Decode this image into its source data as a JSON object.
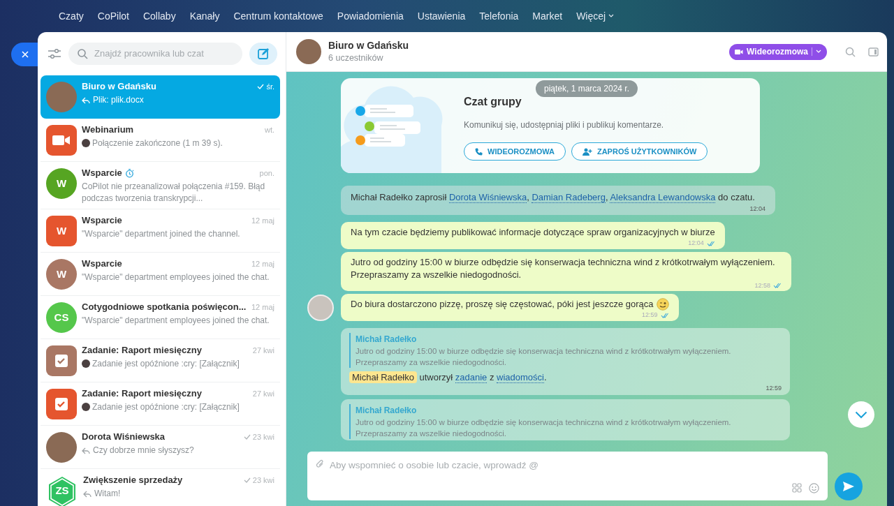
{
  "top_menu": [
    {
      "label": "Czaty",
      "dropdown": false
    },
    {
      "label": "CoPilot",
      "dropdown": false
    },
    {
      "label": "Collaby",
      "dropdown": false
    },
    {
      "label": "Kanały",
      "dropdown": false
    },
    {
      "label": "Centrum kontaktowe",
      "dropdown": false
    },
    {
      "label": "Powiadomienia",
      "dropdown": false
    },
    {
      "label": "Ustawienia",
      "dropdown": false
    },
    {
      "label": "Telefonia",
      "dropdown": false
    },
    {
      "label": "Market",
      "dropdown": false
    },
    {
      "label": "Więcej",
      "dropdown": true
    }
  ],
  "sidebar": {
    "search": {
      "placeholder": "Znajdź pracownika lub czat"
    },
    "chats": [
      {
        "name": "Biuro w Gdańsku",
        "preview": "Plik: plik.docx",
        "reply": true,
        "sender_photo": false,
        "time": "śr.",
        "sent": true,
        "timer": false,
        "selected": true,
        "avatar": {
          "kind": "photo"
        }
      },
      {
        "name": "Webinarium",
        "preview": "Połączenie zakończone (1 m 39 s).",
        "reply": false,
        "sender_photo": true,
        "time": "wt.",
        "sent": false,
        "timer": false,
        "selected": false,
        "avatar": {
          "kind": "video",
          "color": "#e5552e"
        }
      },
      {
        "name": "Wsparcie",
        "preview": "CoPilot nie przeanalizował połączenia #159. Błąd podczas tworzenia transkrypcji...",
        "reply": false,
        "sender_photo": false,
        "time": "pon.",
        "sent": false,
        "timer": true,
        "selected": false,
        "avatar": {
          "kind": "circle",
          "text": "W",
          "color": "#56a522"
        }
      },
      {
        "name": "Wsparcie",
        "preview": "\"Wsparcie\" department joined the channel.",
        "reply": false,
        "sender_photo": false,
        "time": "12 maj",
        "sent": false,
        "timer": false,
        "selected": false,
        "avatar": {
          "kind": "square",
          "text": "W",
          "color": "#e5552e"
        }
      },
      {
        "name": "Wsparcie",
        "preview": "\"Wsparcie\" department employees joined the chat.",
        "reply": false,
        "sender_photo": false,
        "time": "12 maj",
        "sent": false,
        "timer": false,
        "selected": false,
        "avatar": {
          "kind": "circle",
          "text": "W",
          "color": "#a97764"
        }
      },
      {
        "name": "Cotygodniowe spotkania poświęcon...",
        "preview": "\"Wsparcie\" department employees joined the chat.",
        "reply": false,
        "sender_photo": false,
        "time": "12 maj",
        "sent": false,
        "timer": false,
        "selected": false,
        "avatar": {
          "kind": "circle",
          "text": "CS",
          "color": "#55c74b"
        }
      },
      {
        "name": "Zadanie: Raport miesięczny",
        "preview": "Zadanie jest opóźnione :cry: [Załącznik]",
        "reply": false,
        "sender_photo": true,
        "time": "27 kwi",
        "sent": false,
        "timer": false,
        "selected": false,
        "avatar": {
          "kind": "task",
          "color": "#a97764"
        }
      },
      {
        "name": "Zadanie: Raport miesięczny",
        "preview": "Zadanie jest opóźnione :cry: [Załącznik]",
        "reply": false,
        "sender_photo": true,
        "time": "27 kwi",
        "sent": false,
        "timer": false,
        "selected": false,
        "avatar": {
          "kind": "task",
          "color": "#e5552e"
        }
      },
      {
        "name": "Dorota Wiśniewska",
        "preview": "Czy dobrze mnie słyszysz?",
        "reply": true,
        "sender_photo": false,
        "time": "23 kwi",
        "sent": true,
        "timer": false,
        "selected": false,
        "avatar": {
          "kind": "photo"
        }
      },
      {
        "name": "Zwiększenie sprzedaży",
        "preview": "Witam!",
        "reply": true,
        "sender_photo": false,
        "time": "23 kwi",
        "sent": true,
        "timer": false,
        "selected": false,
        "avatar": {
          "kind": "hexagon",
          "text": "ZS",
          "color": "#2fc262"
        }
      }
    ]
  },
  "chat": {
    "title": "Biuro w Gdańsku",
    "subtitle": "6 uczestników",
    "call_button": "Wideorozmowa",
    "date": "piątek, 1 marca 2024 r.",
    "messages": [
      {
        "kind": "intro",
        "title": "Czat grupy",
        "text": "Komunikuj się, udostępniaj pliki i publikuj komentarze.",
        "buttons": [
          "WIDEOROZMOWA",
          "ZAPROŚ UŻYTKOWNIKÓW"
        ]
      },
      {
        "kind": "system",
        "time": "12:04",
        "parts": [
          {
            "kind": "text",
            "text": "Michał Radełko zaprosił "
          },
          {
            "kind": "link",
            "text": "Dorota Wiśniewska"
          },
          {
            "kind": "text",
            "text": ", "
          },
          {
            "kind": "link",
            "text": "Damian Radeberg"
          },
          {
            "kind": "text",
            "text": ", "
          },
          {
            "kind": "link",
            "text": "Aleksandra Lewandowska"
          },
          {
            "kind": "text",
            "text": " do czatu."
          }
        ]
      },
      {
        "kind": "bubble",
        "text": "Na tym czacie będziemy publikować informacje dotyczące spraw organizacyjnych w biurze",
        "time": "12:04",
        "read": true,
        "avatar": false,
        "emoji": false
      },
      {
        "kind": "bubble",
        "text": "Jutro od godziny 15:00 w biurze odbędzie się konserwacja techniczna wind z krótkotrwałym wyłączeniem. Przepraszamy za wszelkie niedogodności.",
        "time": "12:58",
        "read": true,
        "avatar": false,
        "emoji": false
      },
      {
        "kind": "bubble",
        "text": "Do biura dostarczono pizzę, proszę się częstować, póki jest jeszcze gorąca",
        "time": "12:59",
        "read": true,
        "avatar": true,
        "emoji": true
      },
      {
        "kind": "task",
        "quote_author": "Michał Radełko",
        "quote_text": "Jutro od godziny 15:00 w biurze odbędzie się konserwacja techniczna wind z krótkotrwałym wyłączeniem. Przepraszamy za wszelkie niedogodności.",
        "time": "12:59",
        "parts": [
          {
            "kind": "mention",
            "text": "Michał Radełko"
          },
          {
            "kind": "text",
            "text": " utworzył "
          },
          {
            "kind": "link",
            "text": "zadanie"
          },
          {
            "kind": "text",
            "text": " z "
          },
          {
            "kind": "link",
            "text": "wiadomości"
          },
          {
            "kind": "text",
            "text": "."
          }
        ]
      },
      {
        "kind": "task",
        "quote_author": "Michał Radełko",
        "quote_text": "Jutro od godziny 15:00 w biurze odbędzie się konserwacja techniczna wind z krótkotrwałym wyłączeniem. Przepraszamy za wszelkie niedogodności."
      }
    ],
    "composer": {
      "placeholder": "Aby wspomnieć o osobie lub czacie, wprowadź @"
    }
  }
}
